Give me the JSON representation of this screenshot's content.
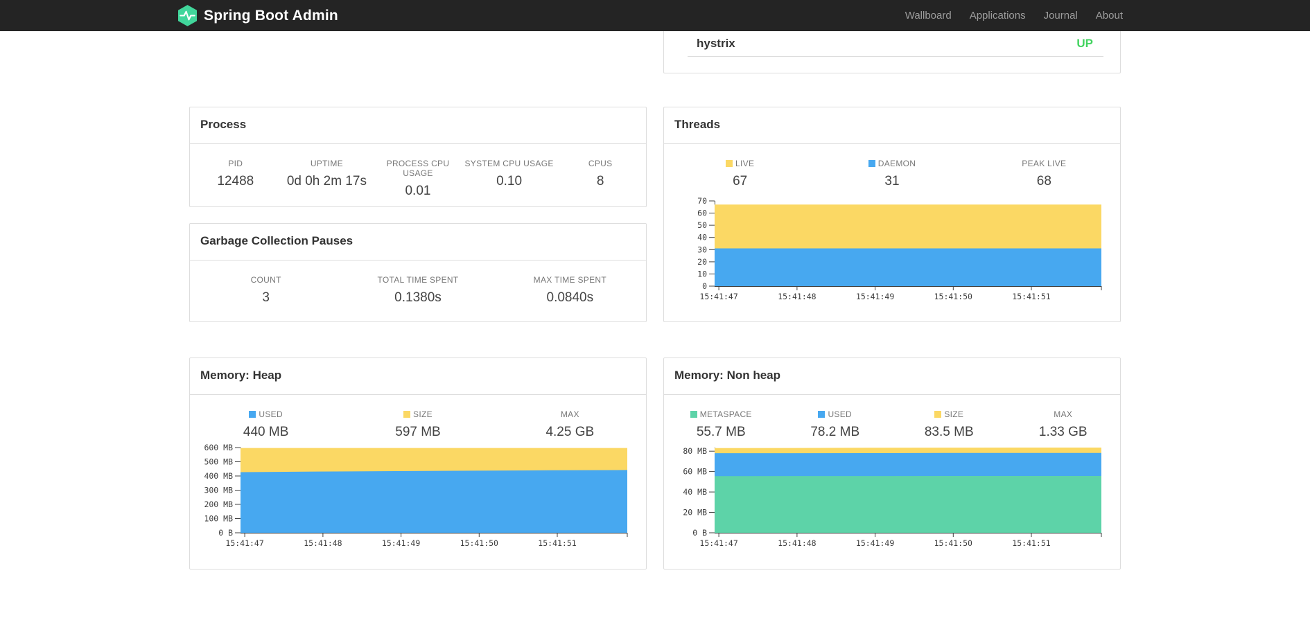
{
  "navbar": {
    "brand": "Spring Boot Admin",
    "links": [
      {
        "label": "Wallboard"
      },
      {
        "label": "Applications"
      },
      {
        "label": "Journal"
      },
      {
        "label": "About"
      }
    ]
  },
  "application": {
    "name": "hystrix",
    "status": "UP",
    "status_color": "#42d35f"
  },
  "theme": {
    "navbar_bg": "#242424",
    "logo_green": "#41d69b",
    "panel_border": "#dddddd",
    "area_yellow": "#fbd864",
    "area_blue": "#47a8f0",
    "area_green": "#5dd3a8"
  },
  "panels": {
    "process": {
      "title": "Process",
      "metrics": [
        {
          "label": "PID",
          "value": "12488"
        },
        {
          "label": "UPTIME",
          "value": "0d 0h 2m 17s"
        },
        {
          "label": "PROCESS CPU USAGE",
          "value": "0.01"
        },
        {
          "label": "SYSTEM CPU USAGE",
          "value": "0.10"
        },
        {
          "label": "CPUS",
          "value": "8"
        }
      ]
    },
    "gc": {
      "title": "Garbage Collection Pauses",
      "metrics": [
        {
          "label": "COUNT",
          "value": "3"
        },
        {
          "label": "TOTAL TIME SPENT",
          "value": "0.1380s"
        },
        {
          "label": "MAX TIME SPENT",
          "value": "0.0840s"
        }
      ]
    },
    "threads": {
      "title": "Threads",
      "metrics": [
        {
          "label": "LIVE",
          "value": "67",
          "color": "#fbd864"
        },
        {
          "label": "DAEMON",
          "value": "31",
          "color": "#47a8f0"
        },
        {
          "label": "PEAK LIVE",
          "value": "68"
        }
      ]
    },
    "heap": {
      "title": "Memory: Heap",
      "metrics": [
        {
          "label": "USED",
          "value": "440 MB",
          "color": "#47a8f0"
        },
        {
          "label": "SIZE",
          "value": "597 MB",
          "color": "#fbd864"
        },
        {
          "label": "MAX",
          "value": "4.25 GB"
        }
      ]
    },
    "nonheap": {
      "title": "Memory: Non heap",
      "metrics": [
        {
          "label": "METASPACE",
          "value": "55.7 MB",
          "color": "#5dd3a8"
        },
        {
          "label": "USED",
          "value": "78.2 MB",
          "color": "#47a8f0"
        },
        {
          "label": "SIZE",
          "value": "83.5 MB",
          "color": "#fbd864"
        },
        {
          "label": "MAX",
          "value": "1.33 GB"
        }
      ]
    }
  },
  "chart_data": [
    {
      "id": "threads",
      "type": "area",
      "title": "Threads",
      "ylim": [
        0,
        70
      ],
      "ymax": 70,
      "grid": false,
      "legend_position": "top",
      "y_ticks": [
        {
          "label": "0",
          "value": 0
        },
        {
          "label": "10",
          "value": 10
        },
        {
          "label": "20",
          "value": 20
        },
        {
          "label": "30",
          "value": 30
        },
        {
          "label": "40",
          "value": 40
        },
        {
          "label": "50",
          "value": 50
        },
        {
          "label": "60",
          "value": 60
        },
        {
          "label": "70",
          "value": 70
        }
      ],
      "x_ticks": [
        "15:41:47",
        "15:41:48",
        "15:41:49",
        "15:41:50",
        "15:41:51"
      ],
      "x_tick_fracs": [
        0.011,
        0.213,
        0.415,
        0.617,
        0.819
      ],
      "series": [
        {
          "name": "LIVE",
          "color": "#fbd864",
          "values": [
            67,
            67,
            67,
            67,
            67,
            67
          ]
        },
        {
          "name": "DAEMON",
          "color": "#47a8f0",
          "values": [
            31,
            31,
            31,
            31,
            31,
            31
          ]
        }
      ]
    },
    {
      "id": "heap",
      "type": "area",
      "title": "Memory: Heap",
      "ylim": [
        0,
        600
      ],
      "ymax": 600,
      "grid": false,
      "legend_position": "top",
      "y_ticks": [
        {
          "label": "0 B",
          "value": 0
        },
        {
          "label": "100 MB",
          "value": 100
        },
        {
          "label": "200 MB",
          "value": 200
        },
        {
          "label": "300 MB",
          "value": 300
        },
        {
          "label": "400 MB",
          "value": 400
        },
        {
          "label": "500 MB",
          "value": 500
        },
        {
          "label": "600 MB",
          "value": 600
        }
      ],
      "x_ticks": [
        "15:41:47",
        "15:41:48",
        "15:41:49",
        "15:41:50",
        "15:41:51"
      ],
      "x_tick_fracs": [
        0.011,
        0.213,
        0.415,
        0.617,
        0.819
      ],
      "series": [
        {
          "name": "SIZE",
          "color": "#fbd864",
          "values": [
            597,
            597,
            597,
            597,
            597,
            597
          ]
        },
        {
          "name": "USED",
          "color": "#47a8f0",
          "values": [
            427,
            431,
            434,
            437,
            440,
            442
          ]
        }
      ]
    },
    {
      "id": "nonheap",
      "type": "area",
      "title": "Memory: Non heap",
      "ylim": [
        0,
        83.5
      ],
      "ymax": 83.5,
      "grid": false,
      "legend_position": "top",
      "y_ticks": [
        {
          "label": "0 B",
          "value": 0
        },
        {
          "label": "20 MB",
          "value": 20
        },
        {
          "label": "40 MB",
          "value": 40
        },
        {
          "label": "60 MB",
          "value": 60
        },
        {
          "label": "80 MB",
          "value": 80
        }
      ],
      "x_ticks": [
        "15:41:47",
        "15:41:48",
        "15:41:49",
        "15:41:50",
        "15:41:51"
      ],
      "x_tick_fracs": [
        0.011,
        0.213,
        0.415,
        0.617,
        0.819
      ],
      "series": [
        {
          "name": "SIZE",
          "color": "#fbd864",
          "values": [
            83.0,
            83.1,
            83.3,
            83.4,
            83.5,
            83.5
          ]
        },
        {
          "name": "USED",
          "color": "#47a8f0",
          "values": [
            78.0,
            78.0,
            78.1,
            78.2,
            78.2,
            78.2
          ]
        },
        {
          "name": "METASPACE",
          "color": "#5dd3a8",
          "values": [
            55.5,
            55.6,
            55.6,
            55.7,
            55.7,
            55.7
          ]
        }
      ]
    }
  ]
}
